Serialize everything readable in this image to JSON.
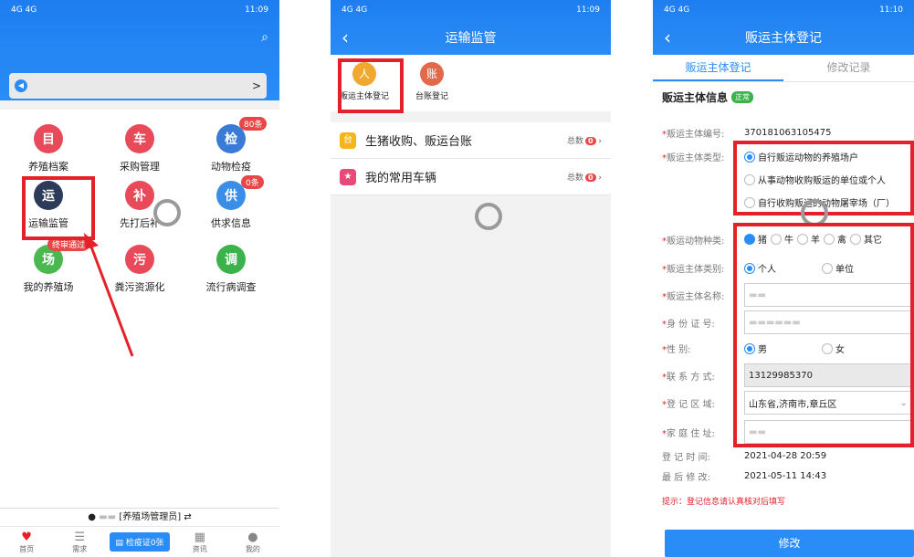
{
  "phone1": {
    "status_time": "11:09",
    "status_left": "4G 4G",
    "notice_arrow": ">",
    "tiles": [
      {
        "label": "养殖档案",
        "color": "#e94a5a",
        "glyph": "目"
      },
      {
        "label": "采购管理",
        "color": "#e94a5a",
        "glyph": "车"
      },
      {
        "label": "动物检疫",
        "color": "#3a7bd5",
        "glyph": "检",
        "badge": "80条"
      },
      {
        "label": "运输监管",
        "color": "#2d3a5a",
        "glyph": "运"
      },
      {
        "label": "先打后补",
        "color": "#e94a5a",
        "glyph": "补"
      },
      {
        "label": "供求信息",
        "color": "#3a8ee8",
        "glyph": "供",
        "badge": "0条"
      },
      {
        "label": "我的养殖场",
        "color": "#4bb84f",
        "glyph": "场",
        "badge": "终审通过"
      },
      {
        "label": "粪污资源化",
        "color": "#e94a5a",
        "glyph": "污"
      },
      {
        "label": "流行病调查",
        "color": "#3bb34a",
        "glyph": "调"
      }
    ],
    "user_bar": "[养殖场管理员]",
    "switch_icon": "⇄",
    "tabbar": [
      {
        "label": "首页",
        "icon": "♥"
      },
      {
        "label": "需求",
        "icon": "☰"
      },
      {
        "label": "检疫证0张",
        "icon": "▤"
      },
      {
        "label": "资讯",
        "icon": "▦"
      },
      {
        "label": "我的",
        "icon": "●"
      }
    ]
  },
  "phone2": {
    "status_time": "11:09",
    "title": "运输监管",
    "cats": [
      {
        "label": "贩运主体登记",
        "color": "#f0a830",
        "glyph": "人"
      },
      {
        "label": "台账登记",
        "color": "#e26a4a",
        "glyph": "账"
      }
    ],
    "rows": [
      {
        "label": "生猪收购、贩运台账",
        "total": "总数",
        "count": "0",
        "color": "#f3b51b",
        "glyph": "台"
      },
      {
        "label": "我的常用车辆",
        "total": "总数",
        "count": "0",
        "color": "#e94a7a",
        "glyph": "★"
      }
    ]
  },
  "phone3": {
    "status_time": "11:10",
    "title": "贩运主体登记",
    "tabs": [
      "贩运主体登记",
      "修改记录"
    ],
    "section": "贩运主体信息",
    "section_tag": "正常",
    "fields": {
      "code_label": "贩运主体编号:",
      "code_value": "370181063105475",
      "type_label": "贩运主体类型:",
      "type_options": [
        "自行贩运动物的养殖场户",
        "从事动物收购贩运的单位或个人",
        "自行收购贩运的动物屠宰场（厂）"
      ],
      "species_label": "贩运动物种类:",
      "species_options": [
        "猪",
        "牛",
        "羊",
        "禽",
        "其它"
      ],
      "category_label": "贩运主体类别:",
      "category_options": [
        "个人",
        "单位"
      ],
      "name_label": "贩运主体名称:",
      "id_label": "身 份 证 号:",
      "gender_label": "性       别:",
      "gender_options": [
        "男",
        "女"
      ],
      "phone_label": "联 系 方 式:",
      "phone_value": "13129985370",
      "region_label": "登 记 区 域:",
      "region_value": "山东省,济南市,章丘区",
      "address_label": "家 庭 住 址:",
      "regtime_label": "登 记 时 间:",
      "regtime_value": "2021-04-28 20:59",
      "modtime_label": "最 后 修 改:",
      "modtime_value": "2021-05-11 14:43"
    },
    "hint": "提示：登记信息请认真核对后填写",
    "submit": "修改"
  }
}
